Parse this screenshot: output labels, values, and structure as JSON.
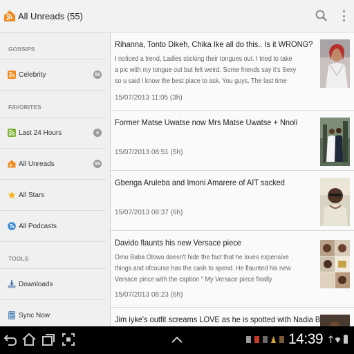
{
  "header": {
    "title": "All Unreads (55)",
    "icons": [
      "rss-logo-icon",
      "search-icon",
      "overflow-menu-icon"
    ]
  },
  "sidebar": {
    "sections": [
      {
        "header": "GOSSIPS",
        "items": [
          {
            "label": "Celebrity",
            "badge": "55",
            "icon": "rss-feed-icon"
          }
        ]
      },
      {
        "header": "FAVORITES",
        "items": [
          {
            "label": "Last 24 Hours",
            "badge": "4",
            "icon": "rss-green-icon"
          },
          {
            "label": "All Unreads",
            "badge": "55",
            "icon": "rss-logo-icon"
          },
          {
            "label": "All Stars",
            "badge": "",
            "icon": "star-icon"
          },
          {
            "label": "All Podcasts",
            "badge": "",
            "icon": "podcast-icon"
          }
        ]
      },
      {
        "header": "TOOLS",
        "items": [
          {
            "label": "Downloads",
            "badge": "",
            "icon": "download-icon"
          },
          {
            "label": "Sync Now",
            "badge": "",
            "icon": "sync-icon"
          }
        ]
      }
    ]
  },
  "articles": [
    {
      "title": "Rihanna, Tonto Dikeh, Chika Ike all do this.. Is it WRONG?",
      "snippet": "I noticed a trend, Ladies sticking their tongues out. I tried to take a pic with my tongue out but felt weird. Some friends say it's Sexy so u said I know the best place to ask. You guys. The last time we talked about taking pics in the",
      "date": "15/07/2013 11:05 (3h)"
    },
    {
      "title": "Former Matse Uwatse now Mrs Matse Uwatse + Nnoli",
      "snippet": "",
      "date": "15/07/2013 08:51 (5h)"
    },
    {
      "title": "Gbenga Aruleba and Imoni Amarere of AIT sacked",
      "snippet": "",
      "date": "15/07/2013 08:37 (6h)"
    },
    {
      "title": "Davido flaunts his new Versace piece",
      "snippet": "Omo Baba Olowo doesn't hide the fact that he loves expensive things and ofcourse has the cash to spend. He flaunted his new Versace piece with the caption \" My Versace piece finally arrived!#versace #OBO #vacation",
      "date": "15/07/2013 08:23 (6h)"
    },
    {
      "title": "Jim iyke's outfit screams LOVE as he is spotted with Nadia Buari",
      "snippet": "",
      "date": ""
    }
  ],
  "navbar": {
    "clock": "14:39",
    "buttons": [
      "back-icon",
      "home-icon",
      "recent-apps-icon",
      "screenshot-icon",
      "chevron-up-icon"
    ]
  },
  "colors": {
    "accent_orange": "#f08a1c",
    "rss_green": "#7fb33a",
    "star_yellow": "#f2b51d",
    "podcast_blue": "#3a8ad6"
  }
}
